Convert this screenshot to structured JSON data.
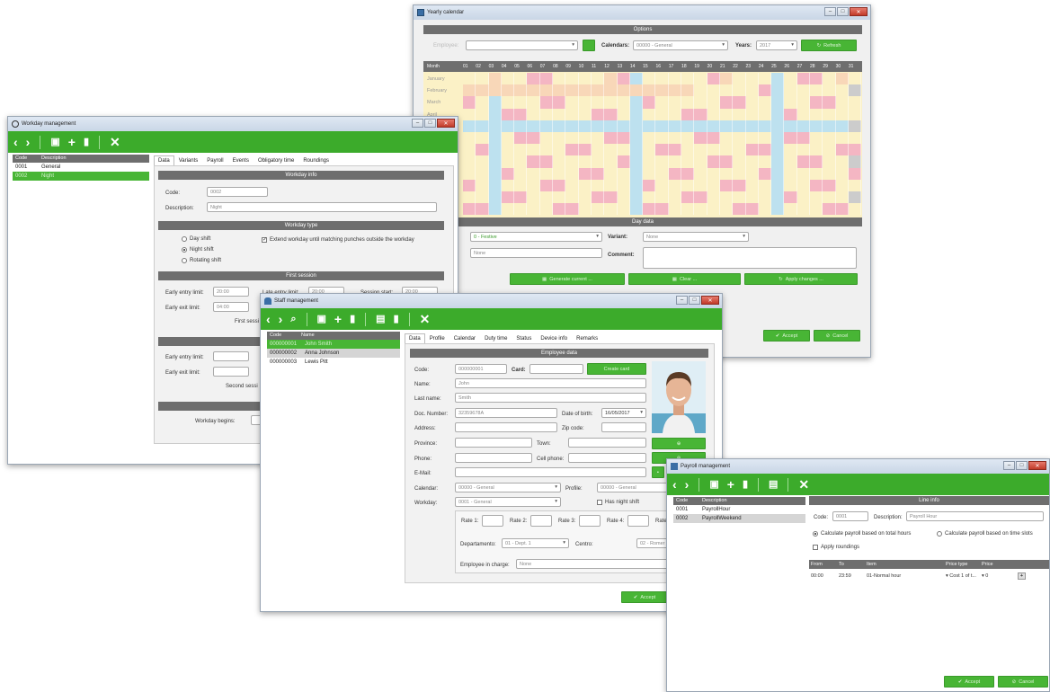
{
  "yearly": {
    "title": "Yearly calendar",
    "options_header": "Options",
    "employee_label": "Employee:",
    "calendars_label": "Calendars:",
    "calendar_value": "00000 - General",
    "years_label": "Years:",
    "year_value": "2017",
    "refresh_label": "Refresh",
    "month_col": "Month",
    "days": [
      "01",
      "02",
      "03",
      "04",
      "05",
      "06",
      "07",
      "08",
      "09",
      "10",
      "11",
      "12",
      "13",
      "14",
      "15",
      "16",
      "17",
      "18",
      "19",
      "20",
      "21",
      "22",
      "23",
      "24",
      "25",
      "26",
      "27",
      "28",
      "29",
      "30",
      "31"
    ],
    "months": [
      "January",
      "February",
      "March",
      "April"
    ],
    "day_data_header": "Day data",
    "day_type_value": "0 - Festive",
    "variant_label": "Variant:",
    "variant_value": "None",
    "none_value": "None",
    "comment_label": "Comment:",
    "btn1": "Generate current ...",
    "btn2": "Clear ...",
    "btn3": "Apply changes ...",
    "accept_label": "Accept",
    "cancel_label": "Cancel",
    "colors": {
      "yellow": "#fbf1c6",
      "pink": "#f4b6c3",
      "blue": "#bde1ef",
      "peach": "#f8d7b8",
      "gray": "#cccccc"
    }
  },
  "workday": {
    "title": "Workday management",
    "list_headers": [
      "Code",
      "Description"
    ],
    "rows": [
      {
        "code": "0001",
        "desc": "General"
      },
      {
        "code": "0002",
        "desc": "Night"
      }
    ],
    "tabs": [
      "Data",
      "Variants",
      "Payroll",
      "Events",
      "Obligatory time",
      "Roundings"
    ],
    "info_header": "Workday info",
    "code_label": "Code:",
    "code_value": "0002",
    "desc_label": "Description:",
    "desc_value": "Night",
    "type_header": "Workday type",
    "day_shift": "Day shift",
    "night_shift": "Night shift",
    "rotating_shift": "Rotating shift",
    "extend_label": "Extend workday until matching punches outside the workday",
    "first_session_header": "First session",
    "early_entry_label": "Early entry limit:",
    "early_entry_value": "20:00",
    "late_entry_label": "Late entry limit:",
    "late_entry_value": "20:00",
    "session_start_label": "Session start:",
    "session_start_value": "20:00",
    "early_exit_label": "Early exit limit:",
    "early_exit_value": "04:00",
    "first_session_text": "First sessi",
    "second_session_text": "Second sessi",
    "workday_begins_label": "Workday begins:"
  },
  "staff": {
    "title": "Staff management",
    "list_headers": [
      "Code",
      "Name"
    ],
    "rows": [
      {
        "code": "000000001",
        "name": "John Smith"
      },
      {
        "code": "000000002",
        "name": "Anna Johnson"
      },
      {
        "code": "000000003",
        "name": "Lewis Pitt"
      }
    ],
    "tabs": [
      "Data",
      "Profile",
      "Calendar",
      "Duty time",
      "Status",
      "Device info",
      "Remarks"
    ],
    "employee_header": "Employee data",
    "code_label": "Code:",
    "code_value": "000000001",
    "card_label": "Card:",
    "name_label": "Name:",
    "name_value": "John",
    "lastname_label": "Last name:",
    "lastname_value": "Smith",
    "doc_label": "Doc. Number:",
    "doc_value": "32359678A",
    "dob_label": "Date of birth:",
    "dob_value": "16/05/2017",
    "address_label": "Address:",
    "zip_label": "Zip code:",
    "province_label": "Province:",
    "town_label": "Town:",
    "phone_label": "Phone:",
    "cell_label": "Cell phone:",
    "email_label": "E-Mail:",
    "calendar_label": "Calendar:",
    "calendar_value": "00000 - General",
    "profile_label": "Profile:",
    "profile_value": "00000 - General",
    "workday_label": "Workday:",
    "workday_value": "0001 - General",
    "night_shift_label": "Has night shift",
    "rates": [
      "Rate 1:",
      "Rate 2:",
      "Rate 3:",
      "Rate 4:",
      "Rate"
    ],
    "dept_label": "Departamento:",
    "dept_value": "01 - Dept. 1",
    "centro_label": "Centro:",
    "centro_value": "02 - Romer",
    "charge_label": "Employee in charge:",
    "charge_value": "None",
    "accept_label": "Accept",
    "card_btn": "Create card"
  },
  "payroll": {
    "title": "Payroll management",
    "list_headers": [
      "Code",
      "Description"
    ],
    "rows": [
      {
        "code": "0001",
        "desc": "PayrollHour"
      },
      {
        "code": "0002",
        "desc": "PayrollWeekend"
      }
    ],
    "line_header": "Line info",
    "code_label": "Code:",
    "code_value": "0001",
    "desc_label": "Description:",
    "desc_value": "Payroll Hour",
    "calc_total": "Calculate payroll based on total hours",
    "calc_slots": "Calculate payroll based on time slots",
    "apply_roundings": "Apply roundings",
    "grid_headers": [
      "From",
      "To",
      "Item",
      "Price type",
      "Price"
    ],
    "grid_row": {
      "from": "00:00",
      "to": "23:59",
      "item": "01-Normal hour",
      "ptype": "▾ Cost 1 of t...",
      "price": "▾ 0"
    },
    "accept_label": "Accept",
    "cancel_label": "Cancel"
  }
}
